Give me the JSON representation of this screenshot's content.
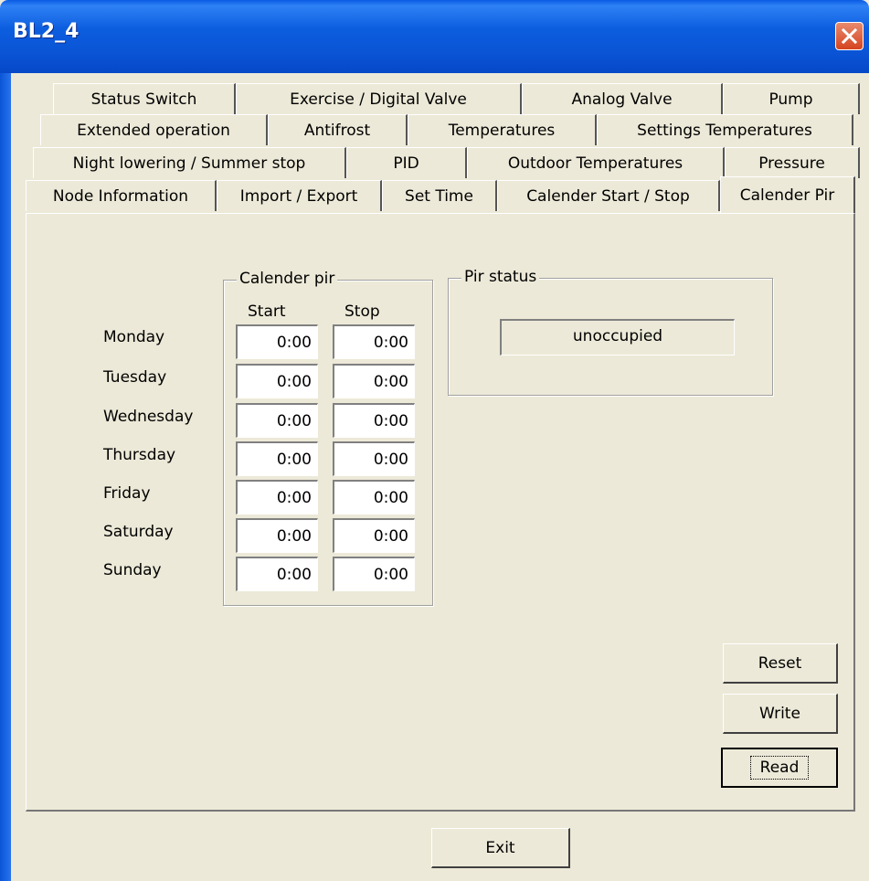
{
  "window": {
    "title": "BL2_4"
  },
  "tabs": {
    "row1": [
      "Status Switch",
      "Exercise / Digital Valve",
      "Analog Valve",
      "Pump"
    ],
    "row2": [
      "Extended operation",
      "Antifrost",
      "Temperatures",
      "Settings Temperatures"
    ],
    "row3": [
      "Night lowering / Summer stop",
      "PID",
      "Outdoor Temperatures",
      "Pressure"
    ],
    "row4": [
      "Node Information",
      "Import / Export",
      "Set Time",
      "Calender Start / Stop",
      "Calender Pir"
    ],
    "selected": "Calender Pir"
  },
  "calender": {
    "group_label": "Calender pir",
    "start_label": "Start",
    "stop_label": "Stop",
    "days": [
      {
        "day": "Monday",
        "start": "0:00",
        "stop": "0:00"
      },
      {
        "day": "Tuesday",
        "start": "0:00",
        "stop": "0:00"
      },
      {
        "day": "Wednesday",
        "start": "0:00",
        "stop": "0:00"
      },
      {
        "day": "Thursday",
        "start": "0:00",
        "stop": "0:00"
      },
      {
        "day": "Friday",
        "start": "0:00",
        "stop": "0:00"
      },
      {
        "day": "Saturday",
        "start": "0:00",
        "stop": "0:00"
      },
      {
        "day": "Sunday",
        "start": "0:00",
        "stop": "0:00"
      }
    ]
  },
  "pir": {
    "group_label": "Pir status",
    "status": "unoccupied"
  },
  "buttons": {
    "reset": "Reset",
    "write": "Write",
    "read": "Read",
    "exit": "Exit"
  },
  "icons": {
    "close": "close-icon"
  },
  "colors": {
    "titlebar": "#0a55d6",
    "close": "#d5431f",
    "face": "#ece9d8"
  }
}
